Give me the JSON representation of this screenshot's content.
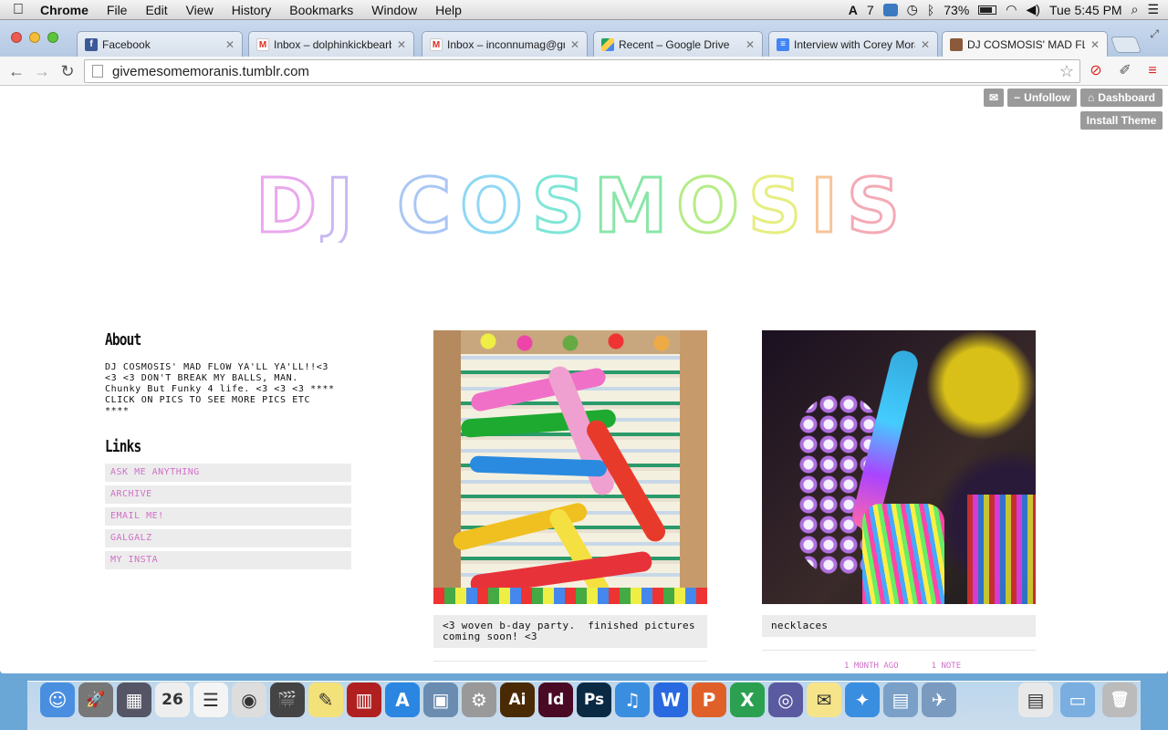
{
  "menubar": {
    "app": "Chrome",
    "items": [
      "File",
      "Edit",
      "View",
      "History",
      "Bookmarks",
      "Window",
      "Help"
    ],
    "status": {
      "adobe_count": "7",
      "battery": "73%",
      "clock": "Tue 5:45 PM"
    }
  },
  "tabs": [
    {
      "label": "Facebook",
      "icon": "facebook-icon",
      "color": "#3b5998"
    },
    {
      "label": "Inbox – dolphinkickbearb",
      "icon": "gmail-icon",
      "color": "#d93025"
    },
    {
      "label": "Inbox – inconnumag@gm",
      "icon": "gmail-icon",
      "color": "#d93025"
    },
    {
      "label": "Recent – Google Drive",
      "icon": "google-drive-icon",
      "color": "#1fa463"
    },
    {
      "label": "Interview with Corey Mora",
      "icon": "google-docs-icon",
      "color": "#4285f4"
    },
    {
      "label": "DJ COSMOSIS' MAD FLOW",
      "icon": "tumblr-avatar-icon",
      "color": "#8a5a3a"
    }
  ],
  "address_bar": {
    "url": "givemesomemoranis.tumblr.com"
  },
  "tumblr_controls": {
    "unfollow": "Unfollow",
    "dashboard": "Dashboard",
    "install_theme": "Install Theme"
  },
  "blog": {
    "title": "DJ COSMOSIS",
    "title_colors": [
      "#e9a8ec",
      "#c9b8f2",
      "#aac6f4",
      "#8ed8f4",
      "#7ee6d6",
      "#8ae6a8",
      "#b6ec86",
      "#e6ee80",
      "#f6c69a",
      "#f4aab6"
    ],
    "about_heading": "About",
    "about_text": "DJ COSMOSIS' MAD FLOW YA'LL YA'LL!!<3\n<3 <3 DON'T BREAK MY BALLS, MAN.\nChunky But Funky 4 life. <3 <3 <3 ****\nCLICK ON PICS TO SEE MORE PICS ETC\n****",
    "links_heading": "Links",
    "links": [
      "ASK ME ANYTHING",
      "ARCHIVE",
      "EMAIL ME!",
      "GALGALZ",
      "MY INSTA"
    ]
  },
  "posts": [
    {
      "caption": "<3 woven b-day party.  finished pictures\ncoming soon! <3",
      "image": "woven-balloons-photo"
    },
    {
      "caption": "necklaces",
      "image": "necklace-photo",
      "meta_date": "1 MONTH AGO",
      "meta_notes": "1 NOTE"
    }
  ],
  "dock": {
    "apps": [
      {
        "name": "finder-icon",
        "color": "#4a8ee0",
        "glyph": "☺"
      },
      {
        "name": "launchpad-icon",
        "color": "#777",
        "glyph": "🚀"
      },
      {
        "name": "mission-control-icon",
        "color": "#556",
        "glyph": "▦"
      },
      {
        "name": "calendar-icon",
        "color": "#eee",
        "glyph": "26"
      },
      {
        "name": "reminders-icon",
        "color": "#f4f4f4",
        "glyph": "☰"
      },
      {
        "name": "chrome-icon",
        "color": "#ddd",
        "glyph": "◉"
      },
      {
        "name": "final-cut-icon",
        "color": "#444",
        "glyph": "🎬"
      },
      {
        "name": "stickies-icon",
        "color": "#f3e17a",
        "glyph": "✎"
      },
      {
        "name": "photo-booth-icon",
        "color": "#b02020",
        "glyph": "▥"
      },
      {
        "name": "app-store-icon",
        "color": "#2a86e0",
        "glyph": "A"
      },
      {
        "name": "iphoto-icon",
        "color": "#6a8cb0",
        "glyph": "▣"
      },
      {
        "name": "system-preferences-icon",
        "color": "#999",
        "glyph": "⚙"
      },
      {
        "name": "illustrator-icon",
        "color": "#4a2a04",
        "glyph": "Ai"
      },
      {
        "name": "indesign-icon",
        "color": "#4a0a26",
        "glyph": "Id"
      },
      {
        "name": "photoshop-icon",
        "color": "#0a2a44",
        "glyph": "Ps"
      },
      {
        "name": "itunes-icon",
        "color": "#3a8ee0",
        "glyph": "♫"
      },
      {
        "name": "word-icon",
        "color": "#2a6ae0",
        "glyph": "W"
      },
      {
        "name": "powerpoint-icon",
        "color": "#e0602a",
        "glyph": "P"
      },
      {
        "name": "excel-icon",
        "color": "#2aa050",
        "glyph": "X"
      },
      {
        "name": "time-warner-icon",
        "color": "#5a5aa0",
        "glyph": "◎"
      },
      {
        "name": "notes-icon",
        "color": "#f6e48a",
        "glyph": "✉"
      },
      {
        "name": "safari-icon",
        "color": "#3a8ee0",
        "glyph": "✦"
      },
      {
        "name": "preview-icon",
        "color": "#7aa0c8",
        "glyph": "▤"
      },
      {
        "name": "mail-icon",
        "color": "#7a9ac0",
        "glyph": "✈"
      }
    ],
    "right": [
      {
        "name": "documents-stack-icon",
        "color": "#e8e8e8",
        "glyph": "▤"
      },
      {
        "name": "downloads-folder-icon",
        "color": "#7aaee0",
        "glyph": "▭"
      },
      {
        "name": "trash-icon",
        "color": "#bbb",
        "glyph": "🗑"
      }
    ]
  }
}
